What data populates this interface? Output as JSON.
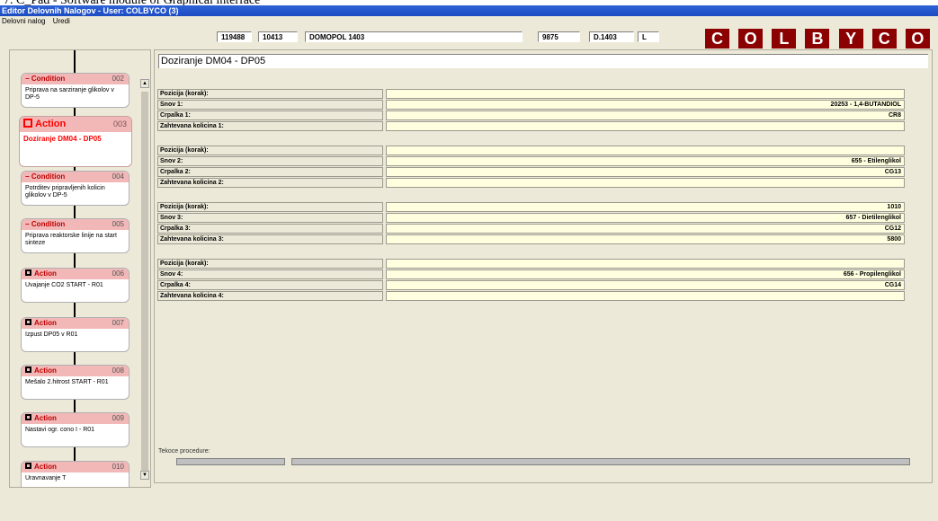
{
  "document_caption": "7. C_Pad - Software module of Graphical interface",
  "window": {
    "title": "Editor Delovnih Nalogov - User: COLBYCO (3)"
  },
  "menu": [
    "Delovni nalog",
    "Uredi"
  ],
  "toolbar": {
    "field_1": "119488",
    "field_2": "10413",
    "field_3": "DOMOPOL 1403",
    "field_4": "9875",
    "field_5": "D.1403",
    "field_6": "L"
  },
  "logo": [
    "C",
    "O",
    "L",
    "B",
    "Y",
    "C",
    "O"
  ],
  "steps": [
    {
      "type": "Condition",
      "num": "002",
      "desc": "Priprava na sarziranje glikolov v DP-5",
      "icon": "minus-icon",
      "active": false
    },
    {
      "type": "Action",
      "num": "003",
      "desc": "Doziranje DM04 - DP05",
      "icon": "square-icon",
      "active": true
    },
    {
      "type": "Condition",
      "num": "004",
      "desc": "Potrditev pripravljenih kolicin glikolov v DP-5",
      "icon": "minus-icon",
      "active": false
    },
    {
      "type": "Condition",
      "num": "005",
      "desc": "Priprava reaktorske linije na start sinteze",
      "icon": "minus-icon",
      "active": false
    },
    {
      "type": "Action",
      "num": "006",
      "desc": "Uvajanje CO2 START - R01",
      "icon": "square-icon",
      "active": false
    },
    {
      "type": "Action",
      "num": "007",
      "desc": "Izpust DP05 v R01",
      "icon": "square-icon",
      "active": false
    },
    {
      "type": "Action",
      "num": "008",
      "desc": "Mešalo 2.hitrost START - R01",
      "icon": "square-icon",
      "active": false
    },
    {
      "type": "Action",
      "num": "009",
      "desc": "Nastavi ogr. cono I - R01",
      "icon": "square-icon",
      "active": false
    },
    {
      "type": "Action",
      "num": "010",
      "desc": "Uravnavanje T",
      "icon": "square-icon",
      "active": false
    }
  ],
  "scrollbar": {
    "up": "▲",
    "down": "▼"
  },
  "detail": {
    "step_title": "Doziranje DM04 - DP05",
    "groups": [
      {
        "rows": [
          {
            "label": "Pozicija (korak):",
            "value": ""
          },
          {
            "label": "Snov 1:",
            "value": "20253 - 1,4-BUTANDIOL"
          },
          {
            "label": "Crpalka 1:",
            "value": "CR8"
          },
          {
            "label": "Zahtevana kolicina 1:",
            "value": ""
          }
        ]
      },
      {
        "rows": [
          {
            "label": "Pozicija (korak):",
            "value": ""
          },
          {
            "label": "Snov 2:",
            "value": "655 - Etilenglikol"
          },
          {
            "label": "Crpalka 2:",
            "value": "CG13"
          },
          {
            "label": "Zahtevana kolicina 2:",
            "value": ""
          }
        ]
      },
      {
        "rows": [
          {
            "label": "Pozicija (korak):",
            "value": "1010"
          },
          {
            "label": "Snov 3:",
            "value": "657 - Dietilenglikol"
          },
          {
            "label": "Crpalka 3:",
            "value": "CG12"
          },
          {
            "label": "Zahtevana kolicina 3:",
            "value": "5800"
          }
        ]
      },
      {
        "rows": [
          {
            "label": "Pozicija (korak):",
            "value": ""
          },
          {
            "label": "Snov 4:",
            "value": "656 - Propilenglikol"
          },
          {
            "label": "Crpalka 4:",
            "value": "CG14"
          },
          {
            "label": "Zahtevana kolicina 4:",
            "value": ""
          }
        ]
      }
    ],
    "progress_label": "Tekoce procedure:"
  }
}
